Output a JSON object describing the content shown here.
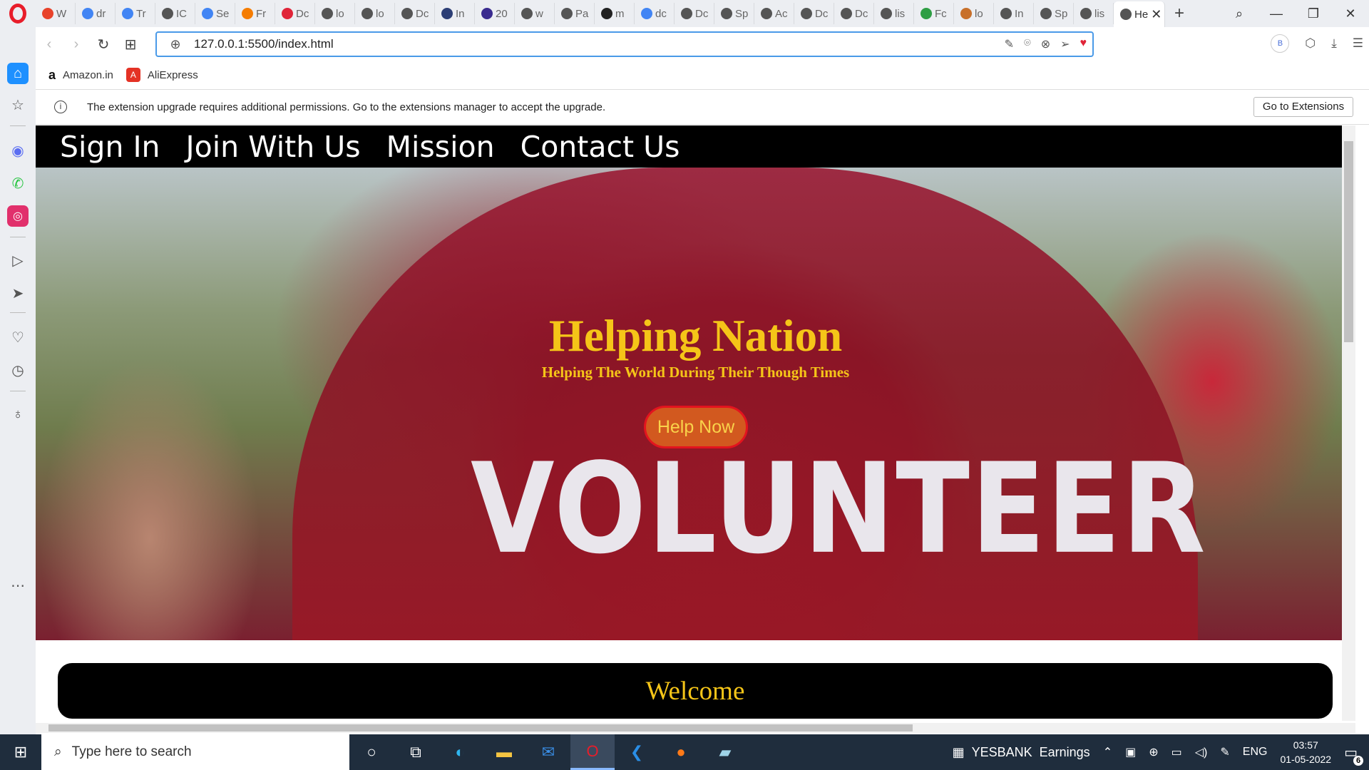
{
  "browser": {
    "tabs": [
      {
        "label": "W",
        "color": "#e8422a"
      },
      {
        "label": "dr",
        "color": "#4285f4"
      },
      {
        "label": "Tr",
        "color": "#4285f4"
      },
      {
        "label": "IC",
        "color": "#555555"
      },
      {
        "label": "Se",
        "color": "#4285f4"
      },
      {
        "label": "Fr",
        "color": "#f57c00"
      },
      {
        "label": "Dc",
        "color": "#e02438"
      },
      {
        "label": "lo",
        "color": "#555555"
      },
      {
        "label": "lo",
        "color": "#555555"
      },
      {
        "label": "Dc",
        "color": "#555555"
      },
      {
        "label": "In",
        "color": "#2c3e75"
      },
      {
        "label": "20",
        "color": "#3a2b8f"
      },
      {
        "label": "w",
        "color": "#555555"
      },
      {
        "label": "Pa",
        "color": "#555555"
      },
      {
        "label": "m",
        "color": "#222222"
      },
      {
        "label": "dc",
        "color": "#4285f4"
      },
      {
        "label": "Dc",
        "color": "#555555"
      },
      {
        "label": "Sp",
        "color": "#555555"
      },
      {
        "label": "Ac",
        "color": "#555555"
      },
      {
        "label": "Dc",
        "color": "#555555"
      },
      {
        "label": "Dc",
        "color": "#555555"
      },
      {
        "label": "lis",
        "color": "#555555"
      },
      {
        "label": "Fc",
        "color": "#2e9e44"
      },
      {
        "label": "lo",
        "color": "#c8702a"
      },
      {
        "label": "In",
        "color": "#555555"
      },
      {
        "label": "Sp",
        "color": "#555555"
      },
      {
        "label": "lis",
        "color": "#555555"
      }
    ],
    "active_tab": {
      "label": "He"
    },
    "new_tab_symbol": "+",
    "address": {
      "url": "127.0.0.1:5500/index.html"
    },
    "profile_badge": "B",
    "bookmarks": [
      {
        "label": "Amazon.in",
        "icon_text": "a"
      },
      {
        "label": "AliExpress",
        "icon_text": "A"
      }
    ],
    "infobar": {
      "message": "The extension upgrade requires additional permissions. Go to the extensions manager to accept the upgrade.",
      "button": "Go to Extensions"
    }
  },
  "site": {
    "nav": [
      "Sign In",
      "Join With Us",
      "Mission",
      "Contact Us"
    ],
    "hero": {
      "title": "Helping Nation",
      "subtitle": "Helping The World During Their Though Times",
      "button": "Help Now",
      "shirt_text": "VOLUNTEER"
    },
    "welcome": "Welcome",
    "colors": {
      "accent": "#f5c518",
      "button_bg": "#d2591f",
      "button_border": "#e3141e",
      "nav_bg": "#000000"
    }
  },
  "taskbar": {
    "search_placeholder": "Type here to search",
    "stock_ticker": "YESBANK",
    "stock_label": "Earnings",
    "language": "ENG",
    "time": "03:57",
    "date": "01-05-2022",
    "notification_count": "6"
  }
}
